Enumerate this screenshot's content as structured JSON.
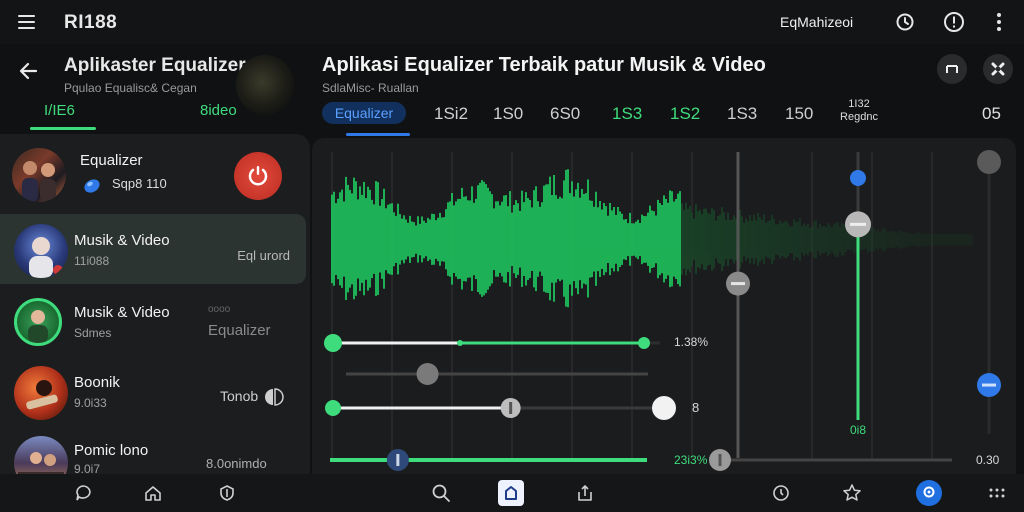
{
  "app": {
    "title": "RI188",
    "top_right_label": "EqMahizeoi"
  },
  "top_icons": [
    "timer-icon",
    "alert-icon",
    "more-vertical-icon"
  ],
  "left_header": {
    "title": "Aplikaster Equalizer",
    "subtitle": "Pqulao Equalisc& Cegan",
    "tabs": [
      {
        "label": "I/IE6",
        "active": true
      },
      {
        "label": "8ideo",
        "active": true
      }
    ]
  },
  "list": [
    {
      "title": "Equalizer",
      "sub": "Sqp8 110",
      "right": "",
      "active": false
    },
    {
      "title": "Musik & Video",
      "sub": "11i088",
      "right": "Eql urord",
      "active": true
    },
    {
      "title": "Musik & Video",
      "sub": "Sdmes",
      "right_top": "oooo",
      "right": "Equalizer",
      "active": false
    },
    {
      "title": "Boonik",
      "sub": "9.0i33",
      "right": "Tonob",
      "active": false
    },
    {
      "title": "Pomic lono",
      "sub": "9.0i7",
      "right": "8.0onimdo",
      "active": false
    }
  ],
  "main_header": {
    "title": "Aplikasi Equalizer Terbaik patur Musik & Video",
    "subtitle": "SdlaMisc- Ruallan"
  },
  "band_tabs": {
    "equalizer_label": "Equalizer",
    "bands": [
      {
        "label": "1Si2",
        "green": false
      },
      {
        "label": "1S0",
        "green": false
      },
      {
        "label": "6S0",
        "green": false
      },
      {
        "label": "1S3",
        "green": true
      },
      {
        "label": "1S2",
        "green": true
      },
      {
        "label": "1S3",
        "green": false
      },
      {
        "label": "150",
        "green": false
      }
    ],
    "stack_top": "1I32",
    "stack_bottom": "Regdnc",
    "last": "05"
  },
  "readouts": {
    "slider1": "1.38%",
    "slider3": "8",
    "vertical": "0i8",
    "bottom_mid": "23i3%",
    "bottom_right": "0.30"
  },
  "sliders": {
    "s1_value": 0.92,
    "s2_value": 0.27,
    "s3_value": 0.54,
    "bottom_value": 0.13,
    "v1_value": 0.57,
    "v2_value": 0.73,
    "v3_value": 0.18
  },
  "colors": {
    "accent": "#3fdc7e",
    "blue": "#2f7ae8",
    "background": "#101112"
  },
  "bottom_nav": [
    "chat-icon",
    "home-icon",
    "shield-icon",
    "search-icon",
    "camera-icon",
    "share-icon",
    "timer-icon",
    "star-icon",
    "profile-icon",
    "grid-icon"
  ]
}
